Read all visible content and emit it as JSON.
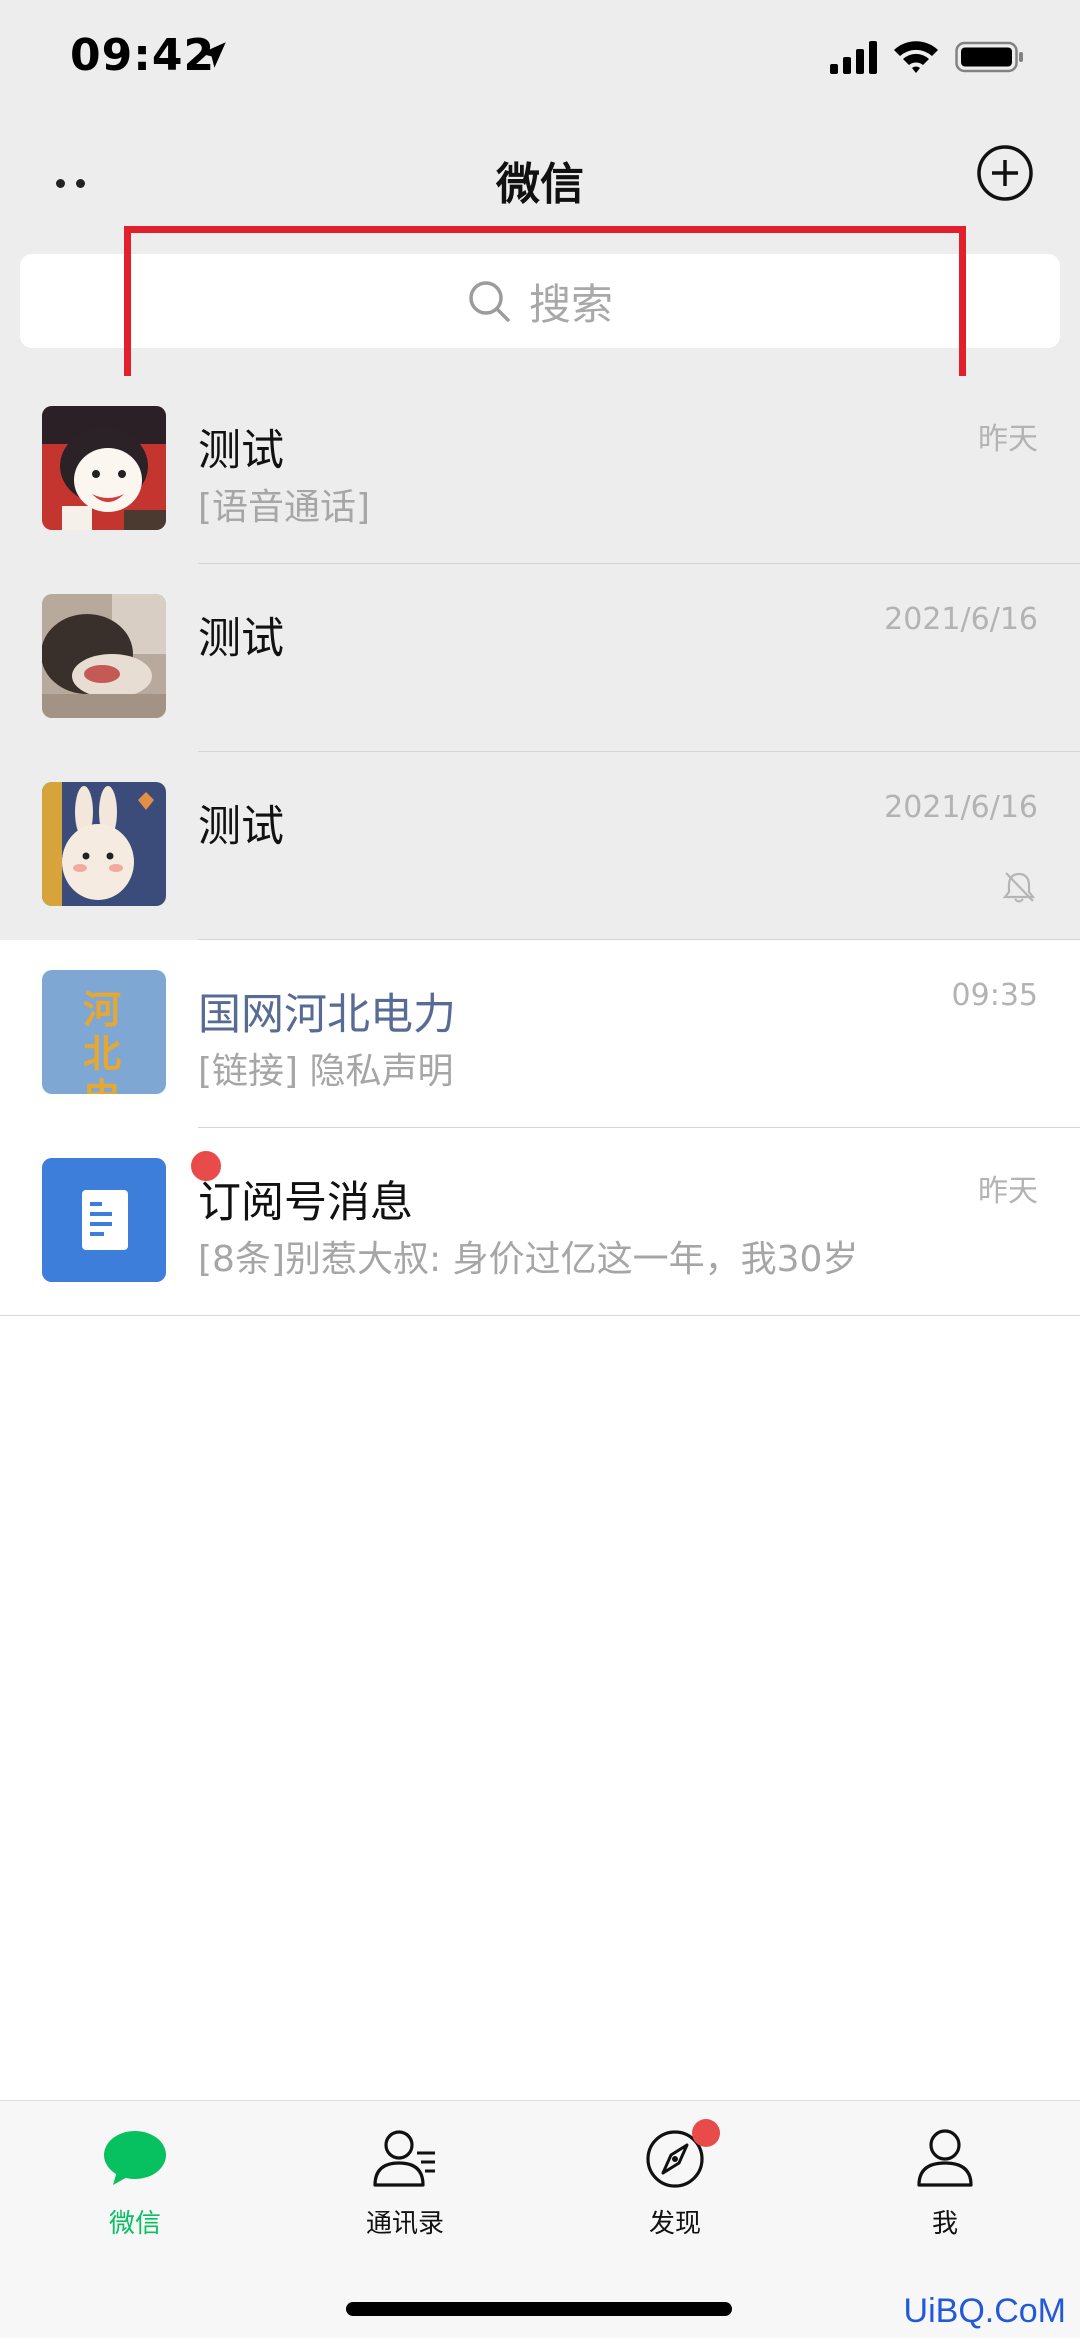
{
  "status_bar": {
    "time": "09:42",
    "icons": [
      "location-arrow-icon",
      "signal-icon",
      "wifi-icon",
      "battery-icon"
    ]
  },
  "header": {
    "title": "微信",
    "icons": [
      "more-icon",
      "add-circle-icon"
    ]
  },
  "search": {
    "placeholder": "搜索",
    "icon": "search-icon"
  },
  "highlight_color": "#e0202c",
  "chats": [
    {
      "name": "测试",
      "preview": "[语音通话]",
      "time": "昨天",
      "pinned": true,
      "avatar": "cartoon-avatar"
    },
    {
      "name": "测试",
      "preview": "",
      "time": "2021/6/16",
      "pinned": true,
      "avatar": "photo-avatar"
    },
    {
      "name": "测试",
      "preview": "",
      "time": "2021/6/16",
      "pinned": true,
      "muted": true,
      "avatar": "bunny-avatar"
    },
    {
      "name": "国网河北电力",
      "preview": "[链接] 隐私声明",
      "time": "09:35",
      "pinned": false,
      "official": true,
      "avatar_text": "河北电力"
    },
    {
      "name": "订阅号消息",
      "preview": "[8条]别惹大叔: 身价过亿这一年，我30岁",
      "time": "昨天",
      "pinned": false,
      "unread": true,
      "avatar": "subscription-icon"
    }
  ],
  "tabs": [
    {
      "label": "微信",
      "icon": "chat-bubble-icon",
      "active": true
    },
    {
      "label": "通讯录",
      "icon": "contacts-icon",
      "active": false
    },
    {
      "label": "发现",
      "icon": "compass-icon",
      "active": false,
      "badge": true
    },
    {
      "label": "我",
      "icon": "person-icon",
      "active": false
    }
  ],
  "colors": {
    "accent": "#07c160",
    "badge": "#e94b4b",
    "official_name": "#576b95"
  },
  "watermark": "UiBQ.CoM"
}
